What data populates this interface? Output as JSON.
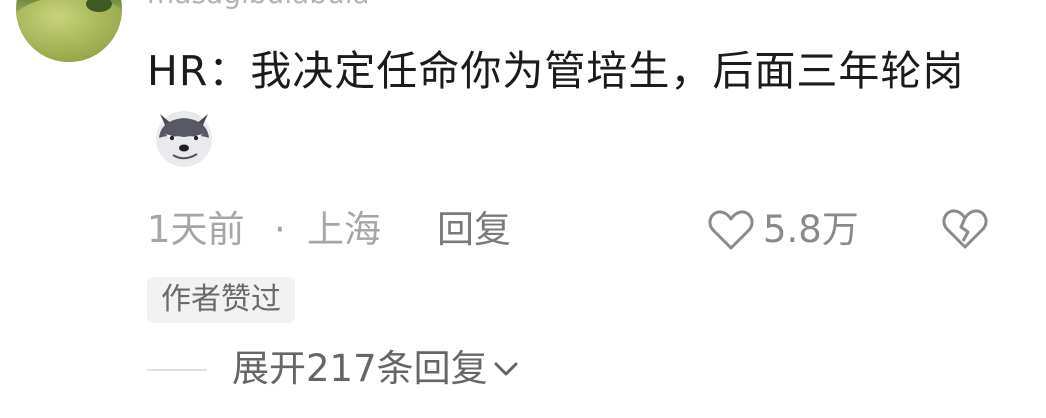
{
  "comment": {
    "username": "masagibulabula",
    "text": "HR：我决定任命你为管培生，后面三年轮岗",
    "emoji": "doge-husky-icon"
  },
  "meta": {
    "time": "1天前",
    "separator": "·",
    "location": "上海",
    "reply_label": "回复",
    "like_count": "5.8万"
  },
  "badge": {
    "author_liked": "作者赞过"
  },
  "replies": {
    "expand_label": "展开217条回复"
  },
  "colors": {
    "text_primary": "#1b1b1b",
    "text_secondary": "#a6a6a6",
    "badge_bg": "#f2f2f2"
  }
}
